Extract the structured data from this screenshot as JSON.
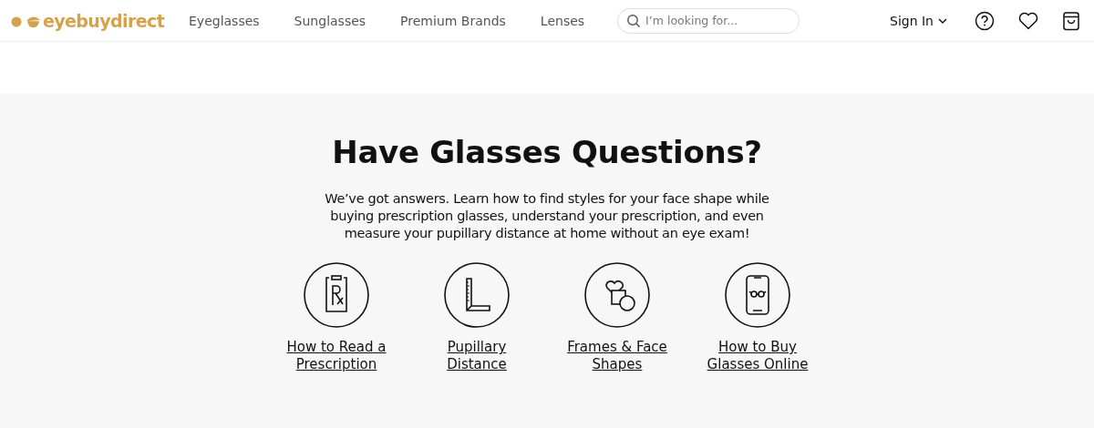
{
  "header": {
    "logo": "eyebuydirect",
    "nav": [
      "Eyeglasses",
      "Sunglasses",
      "Premium Brands",
      "Lenses"
    ],
    "search": {
      "placeholder": "I’m looking for..."
    },
    "sign_in": "Sign In"
  },
  "section": {
    "title": "Have Glasses Questions?",
    "description": "We’ve got answers. Learn how to find styles for your face shape while buying prescription glasses, understand your prescription, and even measure your pupillary distance at home without an eye exam!",
    "topics": [
      {
        "kind": "prescription",
        "label": "How to Read a Prescription"
      },
      {
        "kind": "ruler",
        "label": "Pupillary Distance"
      },
      {
        "kind": "shapes",
        "label": "Frames & Face Shapes"
      },
      {
        "kind": "phone",
        "label": "How to Buy Glasses Online"
      }
    ]
  }
}
